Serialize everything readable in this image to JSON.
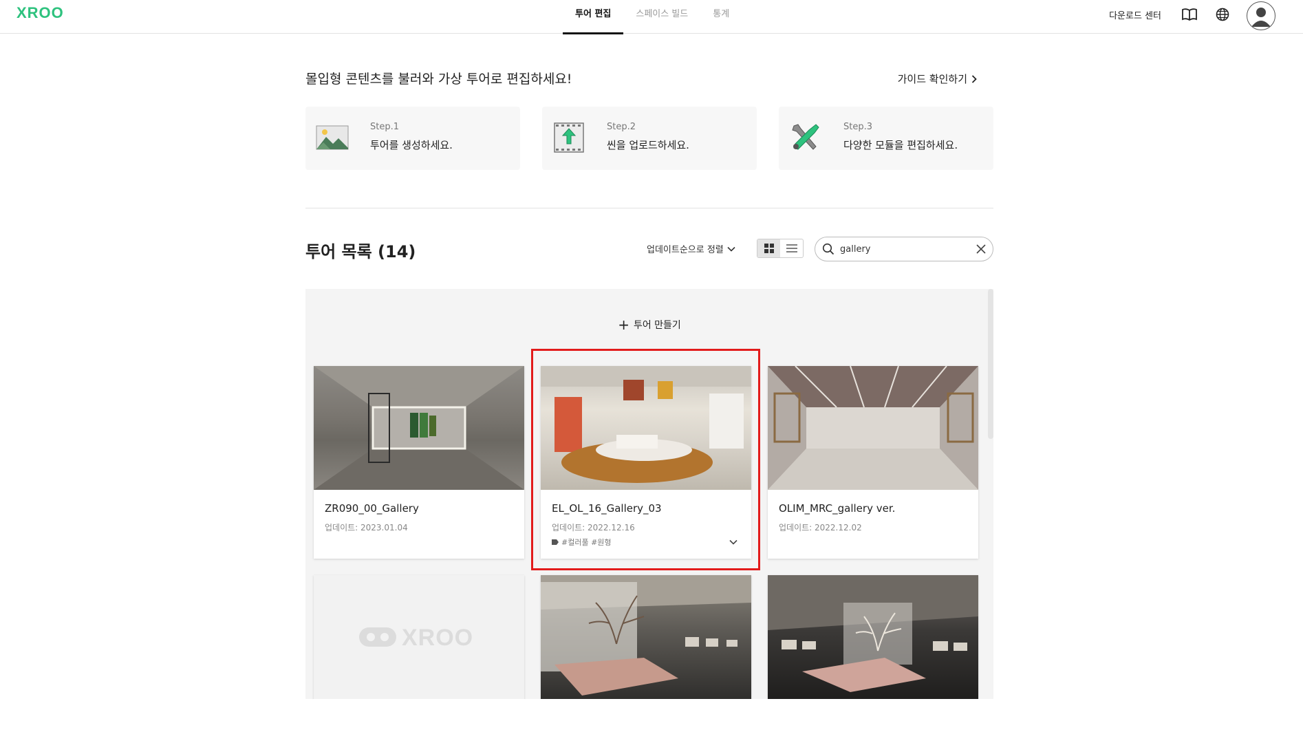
{
  "app": {
    "logo": "XROO",
    "nav_tabs": [
      {
        "label": "투어 편집",
        "active": true
      },
      {
        "label": "스페이스 빌드",
        "active": false
      },
      {
        "label": "통계",
        "active": false
      }
    ],
    "download_center": "다운로드 센터",
    "icons": [
      "book-icon",
      "globe-icon",
      "user-avatar-icon"
    ]
  },
  "intro": {
    "title": "몰입형 콘텐츠를 불러와 가상 투어로 편집하세요!",
    "guide_link": "가이드 확인하기"
  },
  "steps": [
    {
      "label": "Step.1",
      "desc": "투어를 생성하세요.",
      "icon": "landscape-image-icon"
    },
    {
      "label": "Step.2",
      "desc": "씬을 업로드하세요.",
      "icon": "film-upload-icon"
    },
    {
      "label": "Step.3",
      "desc": "다양한 모듈을 편집하세요.",
      "icon": "tools-icon"
    }
  ],
  "list": {
    "title": "투어 목록 (14)",
    "sort_label": "업데이트순으로 정렬",
    "search_value": "gallery",
    "create_label": "투어 만들기"
  },
  "tours": [
    {
      "title": "ZR090_00_Gallery",
      "date": "업데이트: 2023.01.04"
    },
    {
      "title": "EL_OL_16_Gallery_03",
      "date": "업데이트: 2022.12.16",
      "tags": "#컬러풀 #원형"
    },
    {
      "title": "OLIM_MRC_gallery ver.",
      "date": "업데이트: 2022.12.02"
    },
    {
      "title": "",
      "date": "",
      "placeholder_logo": "XROO"
    },
    {
      "title": "",
      "date": ""
    },
    {
      "title": "",
      "date": ""
    }
  ],
  "colors": {
    "brand": "#2ec27e",
    "highlight": "#e21b1b",
    "panel_bg": "#f4f4f4"
  }
}
